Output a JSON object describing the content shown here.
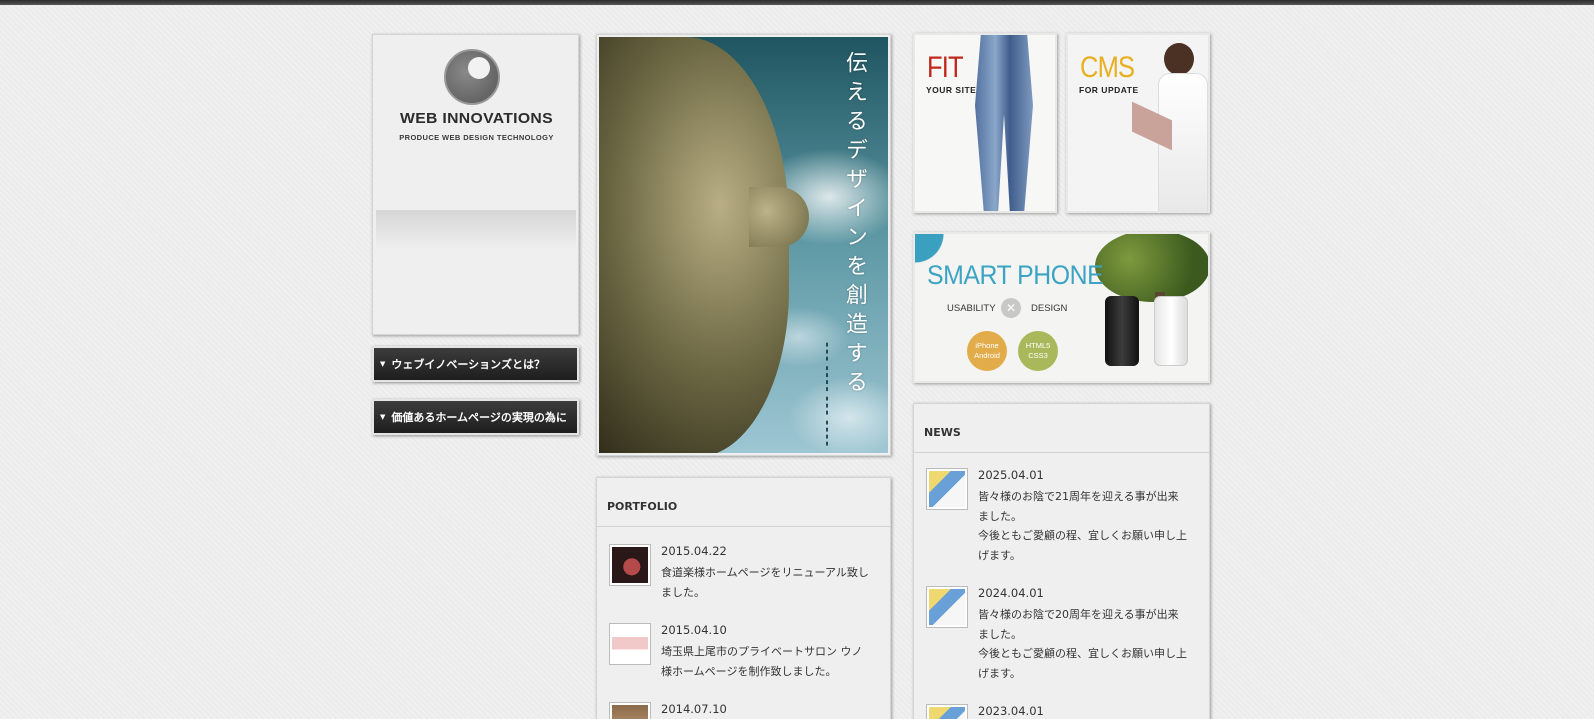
{
  "logo": {
    "title": "WEB INNOVATIONS",
    "tagline": "PRODUCE WEB DESIGN TECHNOLOGY"
  },
  "menu": {
    "items": [
      {
        "label": "ウェブイノベーションズとは？",
        "icon": "triangle-down-icon"
      },
      {
        "label": "価値あるホームページの実現の為に",
        "icon": "triangle-down-icon"
      }
    ]
  },
  "hero": {
    "catchcopy": "伝えるデザインを創造する"
  },
  "banners": {
    "fit": {
      "title": "FIT",
      "subtitle": "YOUR SITE",
      "accent": "#c0281e"
    },
    "cms": {
      "title": "CMS",
      "subtitle": "FOR UPDATE",
      "accent": "#e8b020"
    },
    "smartphone": {
      "title": "SMART PHONE",
      "left": "USABILITY",
      "right": "DESIGN",
      "badge1_line1": "iPhone",
      "badge1_line2": "Android",
      "badge2_line1": "HTML5",
      "badge2_line2": "CSS3",
      "accent": "#3ba3c4"
    }
  },
  "portfolio": {
    "title": "PORTFOLIO",
    "items": [
      {
        "date": "2015.04.22",
        "text": "食道楽様ホームページをリニューアル致しました。"
      },
      {
        "date": "2015.04.10",
        "text": "埼玉県上尾市のプライベートサロン ウノ様ホームページを制作致しました。"
      },
      {
        "date": "2014.07.10",
        "text": ""
      }
    ]
  },
  "news": {
    "title": "NEWS",
    "items": [
      {
        "date": "2025.04.01",
        "text": "皆々様のお陰で21周年を迎える事が出来ました。",
        "text2": "今後ともご愛顧の程、宜しくお願い申し上げます。"
      },
      {
        "date": "2024.04.01",
        "text": "皆々様のお陰で20周年を迎える事が出来ました。",
        "text2": "今後ともご愛顧の程、宜しくお願い申し上げます。"
      },
      {
        "date": "2023.04.01",
        "text": "",
        "text2": ""
      }
    ]
  }
}
